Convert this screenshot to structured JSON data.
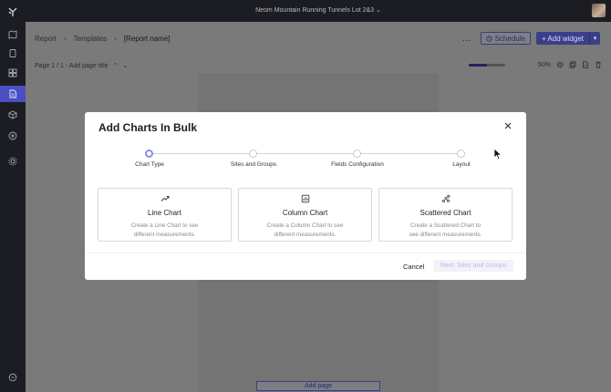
{
  "app": {
    "project_title": "Neom Mountain Running Tunnels Lot 2&3"
  },
  "sidebar": {
    "items": [
      {
        "icon": "map-icon"
      },
      {
        "icon": "clipboard-icon"
      },
      {
        "icon": "dashboard-icon"
      },
      {
        "icon": "report-icon",
        "active": true
      },
      {
        "icon": "box-icon"
      },
      {
        "icon": "circle-x-icon"
      },
      {
        "icon": "gear-icon"
      },
      {
        "icon": "chat-icon"
      }
    ]
  },
  "header": {
    "breadcrumb": [
      "Report",
      "Templates",
      "[Report name]"
    ],
    "more": "…",
    "schedule_label": "Schedule",
    "add_widget_label": "+ Add widget"
  },
  "page_bar": {
    "page_label": "Page 1 / 1 - Add page title",
    "zoom_percent": 50,
    "zoom_text": "50%"
  },
  "add_page_label": "Add page",
  "modal": {
    "title": "Add Charts In Bulk",
    "steps": [
      {
        "label": "Chart Type",
        "active": true
      },
      {
        "label": "Sites and Groups",
        "active": false
      },
      {
        "label": "Fields Configuration",
        "active": false
      },
      {
        "label": "Layout",
        "active": false
      }
    ],
    "cards": [
      {
        "title": "Line Chart",
        "desc": "Create a Line Chart to see different measurements.",
        "icon": "trend-line-icon"
      },
      {
        "title": "Column Chart",
        "desc": "Create a Column Chart to see different measurements.",
        "icon": "column-chart-icon"
      },
      {
        "title": "Scattered Chart",
        "desc": "Create a Scattered Chart to see different measurements.",
        "icon": "scatter-chart-icon"
      }
    ],
    "cancel_label": "Cancel",
    "next_label": "Next: Sites and Groups"
  },
  "colors": {
    "accent": "#4a4fc4",
    "step_active": "#8e8ee8",
    "sidebar_bg": "#1b1d22"
  }
}
